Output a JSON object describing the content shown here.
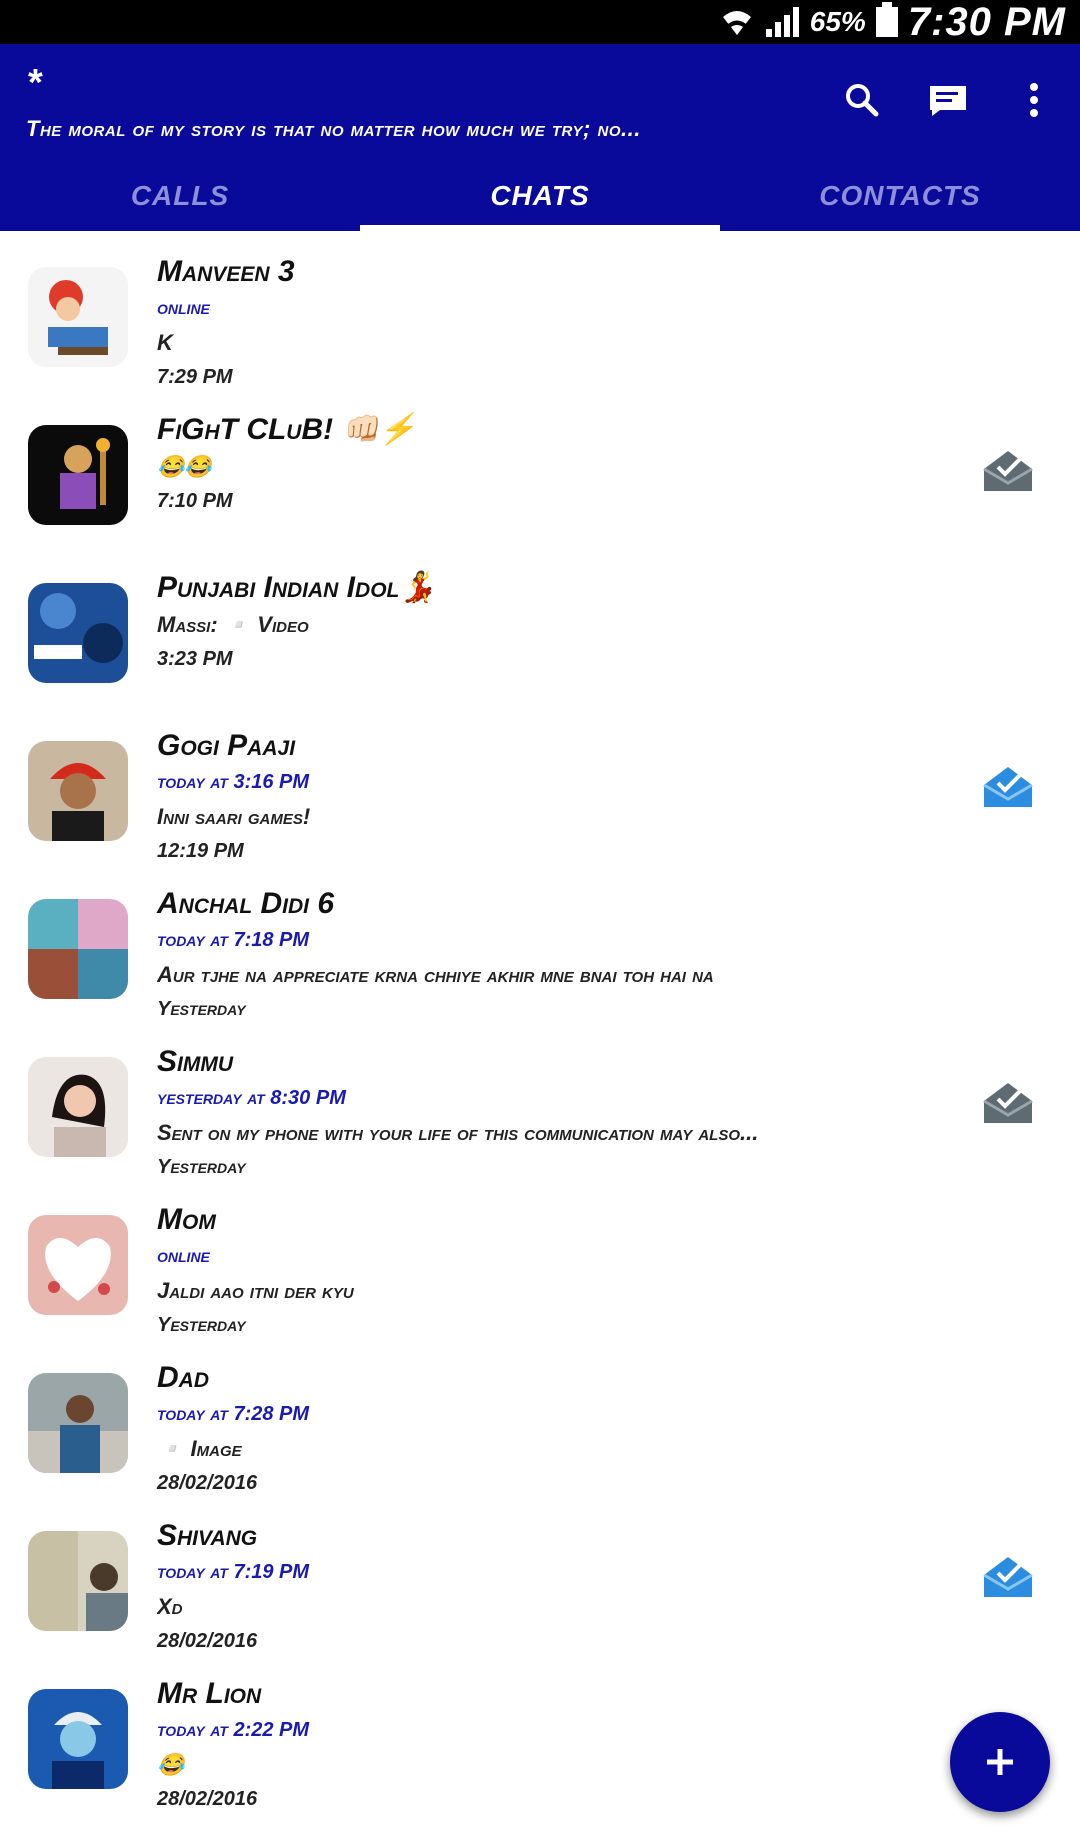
{
  "statusbar": {
    "battery": "65%",
    "time": "7:30 PM"
  },
  "appbar": {
    "title": "*",
    "status": "The moral of my story is that no matter how much we try; no..."
  },
  "tabs": [
    {
      "label": "CALLS",
      "active": false
    },
    {
      "label": "CHATS",
      "active": true
    },
    {
      "label": "CONTACTS",
      "active": false
    }
  ],
  "chats": [
    {
      "name": "Manveen 3",
      "status": "online",
      "message": "K",
      "time": "7:29 PM",
      "read_icon": "none"
    },
    {
      "name": "FiGhT CLuB! 👊🏻⚡",
      "status": "",
      "message": "😂😂",
      "time": "7:10 PM",
      "read_icon": "grey"
    },
    {
      "name": "Punjabi Indian Idol💃",
      "status": "",
      "message": "Massi: ▫️ Video",
      "time": "3:23 PM",
      "read_icon": "none"
    },
    {
      "name": "Gogi Paaji",
      "status": "today at 3:16 PM",
      "message": "Inni saari games!",
      "time": "12:19 PM",
      "read_icon": "blue"
    },
    {
      "name": "Anchal Didi 6",
      "status": "today at 7:18 PM",
      "message": "Aur tjhe na appreciate krna chhiye akhir mne bnai toh hai na",
      "time": "Yesterday",
      "read_icon": "none"
    },
    {
      "name": "Simmu",
      "status": "yesterday at 8:30 PM",
      "message": "Sent on my phone with your life of this communication may also...",
      "time": "Yesterday",
      "read_icon": "grey"
    },
    {
      "name": "Mom",
      "status": "online",
      "message": "Jaldi aao itni der kyu",
      "time": "Yesterday",
      "read_icon": "none"
    },
    {
      "name": "Dad",
      "status": "today at 7:28 PM",
      "message": "▫️ Image",
      "time": "28/02/2016",
      "read_icon": "none"
    },
    {
      "name": "Shivang",
      "status": "today at 7:19 PM",
      "message": "Xd",
      "time": "28/02/2016",
      "read_icon": "blue"
    },
    {
      "name": "Mr Lion",
      "status": "today at 2:22 PM",
      "message": "😂",
      "time": "28/02/2016",
      "read_icon": "none"
    }
  ],
  "icons": {
    "search": "search-icon",
    "compose": "message-icon",
    "overflow": "more-vert-icon",
    "fab": "plus-icon"
  },
  "colors": {
    "primary": "#0a0a9a",
    "status_text": "#1a1ab0",
    "read_blue": "#2b8de0",
    "read_grey": "#5f6b73"
  }
}
